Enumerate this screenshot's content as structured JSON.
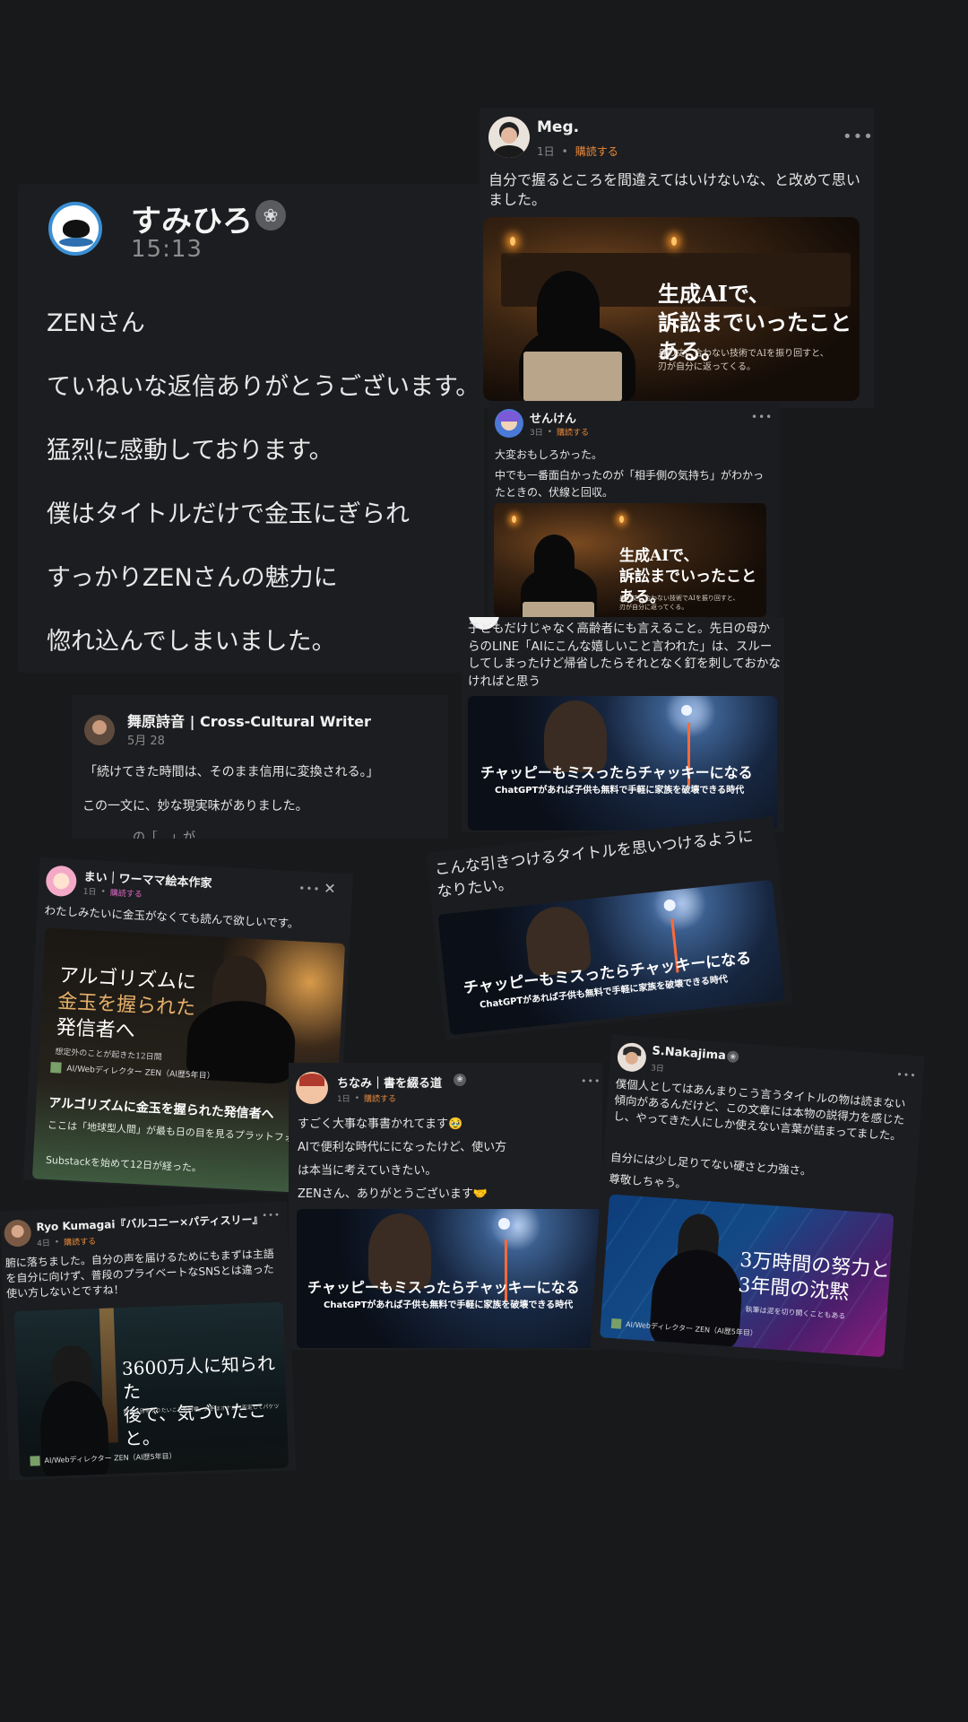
{
  "sumihiro": {
    "name": "すみひろ",
    "time": "15:13",
    "lines": [
      "ZENさん",
      "ていねいな返信ありがとうございます。",
      "猛烈に感動しております。",
      "僕はタイトルだけで金玉にぎられ",
      "すっかりZENさんの魅力に",
      "惚れ込んでしまいました。"
    ]
  },
  "meg": {
    "name": "Meg.",
    "time": "1日",
    "subscribe": "購読する",
    "text": "自分で握るところを間違えてはいけないな、と改めて思いました。",
    "thumb_title": [
      "生成AIで、",
      "訴訟までいったことある。"
    ],
    "thumb_sub": [
      "身の丈に合わない技術でAIを振り回すと、",
      "刃が自分に返ってくる。"
    ]
  },
  "senken": {
    "name": "せんけん",
    "time": "3日",
    "subscribe": "購読する",
    "text1": "大変おもしろかった。",
    "text2": "中でも一番面白かったのが「相手側の気持ち」がわかったときの、伏線と回収。",
    "thumb_title": [
      "生成AIで、",
      "訴訟までいったことある。"
    ],
    "thumb_sub": [
      "身の丈に合わない技術でAIを振り回すと、",
      "刃が自分に返ってくる。"
    ]
  },
  "line_post": {
    "text": "子どもだけじゃなく高齢者にも言えること。先日の母からのLINE「AIにこんな嬉しいこと言われた」は、スルーしてしまったけど帰省したらそれとなく釘を刺しておかなければと思う"
  },
  "chucky": {
    "title": "チャッピーもミスったらチャッキーになる",
    "sub": "ChatGPTがあれば子供も無料で手軽に家族を破壊できる時代"
  },
  "maihara": {
    "name": "舞原詩音 | Cross-Cultural Writer",
    "date": "5月 28",
    "quote": "「続けてきた時間は、そのまま信用に変換される。」",
    "text": "この一文に、妙な現実味がありました。",
    "cut": "…………の「…」が…………"
  },
  "hikitsuke": {
    "text": "こんな引きつけるタイトルを思いつけるようになりたい。"
  },
  "mai": {
    "name": "まい｜ワーママ絵本作家",
    "time": "1日",
    "subscribe": "購読する",
    "text": "わたしみたいに金玉がなくても読んで欲しいです。",
    "thumb_title": [
      "アルゴリズムに",
      "金玉を握られた",
      "発信者へ"
    ],
    "thumb_sub": "想定外のことが起きた12日間",
    "author": "AI/Webディレクター ZEN（AI歴5年目）",
    "article_title": "アルゴリズムに金玉を握られた発信者へ",
    "article_desc": "ここは「地球型人間」が最も日の目を見るプラットフォーム",
    "article_desc2": "Substackを始めて12日が経った。"
  },
  "chinami": {
    "name": "ちなみ｜書を綴る道",
    "time": "1日",
    "subscribe": "購読する",
    "lines": [
      "すごく大事な事書かれてます🥹",
      "AIで便利な時代にになったけど、使い方",
      "は本当に考えていきたい。",
      "ZENさん、ありがとうございます🤝"
    ]
  },
  "nakajima": {
    "name": "S.Nakajima",
    "time": "3日",
    "text1": "僕個人としてはあんまりこう言うタイトルの物は読まない傾向があるんだけど、この文章には本物の説得力を感じたし、やってきた人にしか使えない言葉が詰まってました。",
    "text2": "自分には少し足りてない硬さと力強さ。",
    "text3": "尊敬しちゃう。",
    "thumb_title": [
      "3万時間の努力と",
      "3年間の沈黙"
    ],
    "thumb_sub": "執筆は泥を切り開くこともある",
    "author": "AI/Webディレクター ZEN（AI歴5年目）"
  },
  "ryo": {
    "name": "Ryo Kumagai『バルコニー×パティスリー』",
    "time": "4日",
    "subscribe": "購読する",
    "text": "腑に落ちました。自分の声を届けるためにもまずは主語を自分に向けず、普段のプライベートなSNSとは違った使い方しないとですね！",
    "thumb_title": [
      "3600万人に知られた",
      "後で、気づいたこと。"
    ],
    "thumb_sub": "好きに目をやりたいことを目標。大手はオナニー否定してパケツ",
    "author": "AI/Webディレクター ZEN（AI歴5年目）"
  }
}
